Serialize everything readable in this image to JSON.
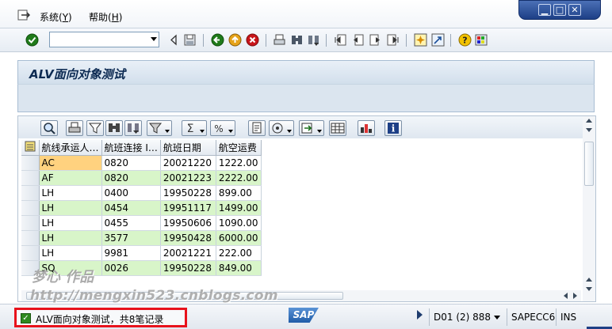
{
  "menubar": {
    "items": [
      {
        "label": "系统(",
        "mnemonic": "Y",
        "suffix": ")"
      },
      {
        "label": "帮助(",
        "mnemonic": "H",
        "suffix": ")"
      }
    ]
  },
  "window_controls": {
    "minimize": "▁",
    "maximize": "□",
    "close": "✕"
  },
  "toolbar": {
    "command_field_value": "",
    "icons": [
      "enter-icon",
      "back-icon",
      "save-icon",
      "exit-icon",
      "cancel-icon",
      "print-icon",
      "find-icon",
      "find-next-icon",
      "first-page-icon",
      "prev-page-icon",
      "next-page-icon",
      "last-page-icon",
      "create-session-icon",
      "shortcut-icon",
      "help-icon",
      "customize-icon"
    ]
  },
  "screen": {
    "title": "ALV面向对象测试"
  },
  "alv": {
    "toolbar_icons": [
      "details-icon",
      "print-icon",
      "filter-icon",
      "find-icon",
      "find-next-icon",
      "set-filter-icon",
      "sum-icon",
      "subtotal-icon",
      "print-preview-icon",
      "excel-export-icon",
      "layout-icon",
      "graphic-icon",
      "info-icon"
    ],
    "columns": [
      "航线承运人…",
      "航班连接 I…",
      "航班日期",
      "航空运费"
    ],
    "rows": [
      [
        "AC",
        "0820",
        "20021220",
        "1222.00"
      ],
      [
        "AF",
        "0820",
        "20021223",
        "2222.00"
      ],
      [
        "LH",
        "0400",
        "19950228",
        "899.00"
      ],
      [
        "LH",
        "0454",
        "19951117",
        "1499.00"
      ],
      [
        "LH",
        "0455",
        "19950606",
        "1090.00"
      ],
      [
        "LH",
        "3577",
        "19950428",
        "6000.00"
      ],
      [
        "LH",
        "9981",
        "20021221",
        "222.00"
      ],
      [
        "SQ",
        "0026",
        "19950228",
        "849.00"
      ]
    ]
  },
  "watermark": {
    "line1": "梦心 作品",
    "line2": "http://mengxin523.cnblogs.com"
  },
  "statusbar": {
    "message": "ALV面向对象测试，共8笔记录",
    "logo": "SAP",
    "system": "D01 (2) 888",
    "server": "SAPECC6",
    "mode": "INS"
  },
  "colors": {
    "row_even": "#d8f5c9",
    "row_odd": "#ffffff",
    "key_cell_highlight": "#ffd27f",
    "status_highlight_border": "#e8121c"
  }
}
